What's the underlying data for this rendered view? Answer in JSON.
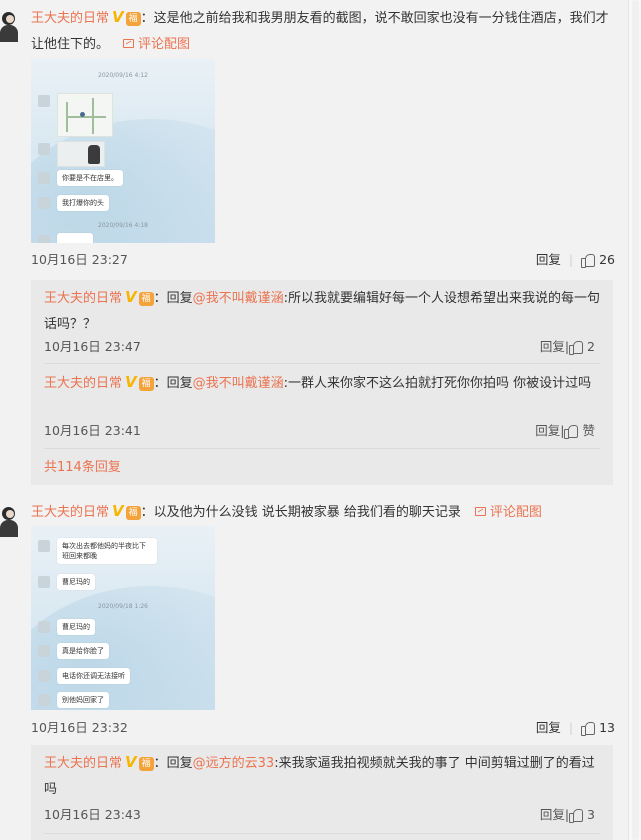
{
  "comments": [
    {
      "username": "王大夫的日常",
      "badge_v": "V",
      "badge_g": "福",
      "text": "：这是他之前给我和我男朋友看的截图，说不敢回家也没有一分钱住酒店，我们才让他住下的。",
      "pic_link": "评论配图",
      "time": "10月16日 23:27",
      "reply_label": "回复",
      "likes": "26",
      "image": {
        "timestamp_top": "2020/09/16 4:12",
        "bubble1": "你要是不在店里。",
        "bubble2": "我打爆你的头",
        "timestamp_bottom": "2020/09/16 4:18"
      },
      "replies": [
        {
          "username": "王大夫的日常",
          "reply_prefix": "：回复",
          "at_user": "@我不叫戴谨涵",
          "text": ":所以我就要编辑好每一个人设想希望出来我说的每一句话吗？？",
          "time": "10月16日 23:47",
          "reply_label": "回复",
          "likes": "2"
        },
        {
          "username": "王大夫的日常",
          "reply_prefix": "：回复",
          "at_user": "@我不叫戴谨涵",
          "text": ":一群人来你家不这么拍就打死你你拍吗 你被设计过吗",
          "time": "10月16日 23:41",
          "reply_label": "回复",
          "likes": "赞"
        }
      ],
      "more_replies": "共114条回复"
    },
    {
      "username": "王大夫的日常",
      "badge_v": "V",
      "badge_g": "福",
      "text": "：以及他为什么没钱 说长期被家暴 给我们看的聊天记录",
      "pic_link": "评论配图",
      "time": "10月16日 23:32",
      "reply_label": "回复",
      "likes": "13",
      "image": {
        "bubble1": "每次出去都他妈的半夜比下班回来都晚",
        "bubble2": "曹尼玛的",
        "timestamp_mid": "2020/09/18 1:26",
        "bubble3": "曹尼玛的",
        "bubble4": "真是给你脸了",
        "bubble5": "电话你还调无法接听",
        "bubble6": "别他妈回家了"
      },
      "replies": [
        {
          "username": "王大夫的日常",
          "reply_prefix": "：回复",
          "at_user": "@远方的云33",
          "text": ":来我家逼我拍视频就关我的事了 中间剪辑过删了的看过吗",
          "time": "10月16日 23:43",
          "reply_label": "回复",
          "likes": "3"
        }
      ]
    }
  ]
}
